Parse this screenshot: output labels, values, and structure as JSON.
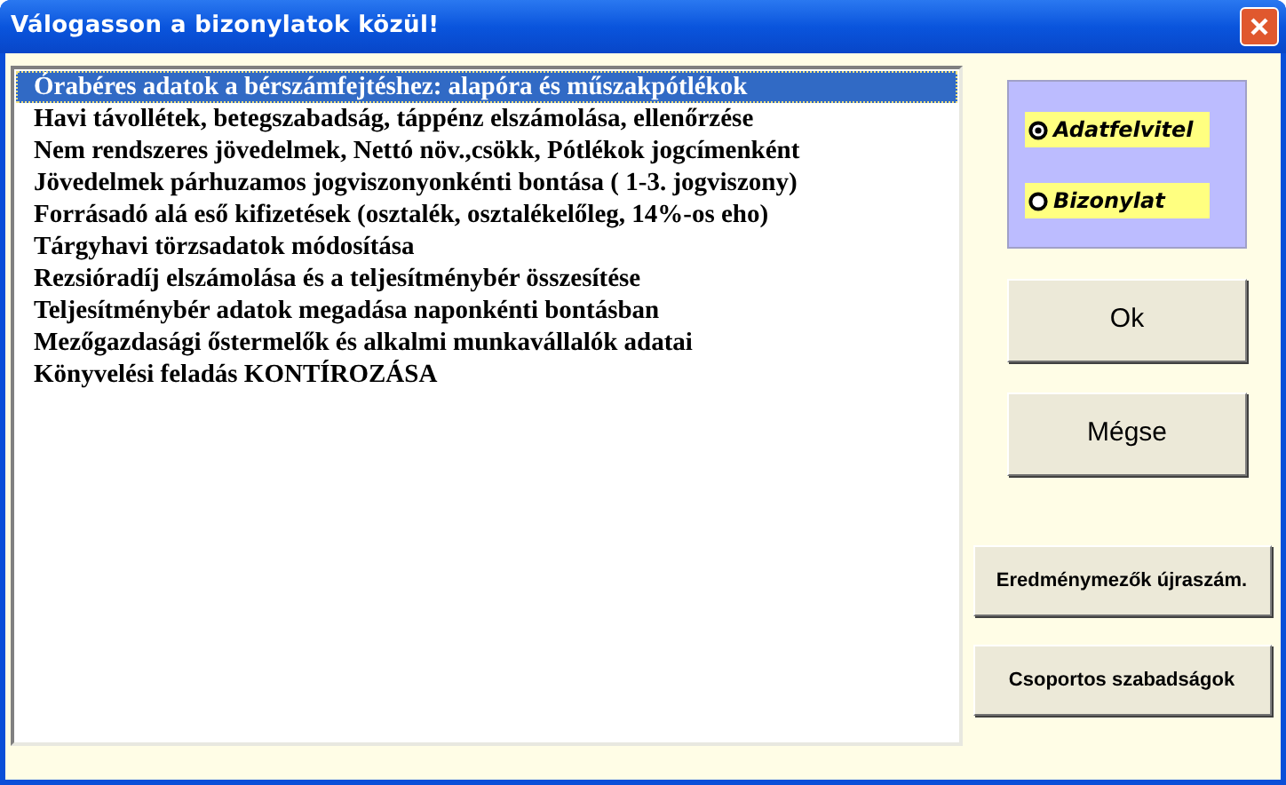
{
  "window": {
    "title": "Válogasson a bizonylatok közül!"
  },
  "list": {
    "items": [
      {
        "label": "Órabéres adatok a bérszámfejtéshez: alapóra és műszakpótlékok",
        "selected": true
      },
      {
        "label": "Havi távollétek, betegszabadság, táppénz elszámolása, ellenőrzése",
        "selected": false
      },
      {
        "label": "Nem rendszeres jövedelmek, Nettó növ.,csökk, Pótlékok jogcímenként",
        "selected": false
      },
      {
        "label": "Jövedelmek párhuzamos jogviszonyonkénti bontása ( 1-3. jogviszony)",
        "selected": false
      },
      {
        "label": "Forrásadó alá eső kifizetések (osztalék, osztalékelőleg, 14%-os eho)",
        "selected": false
      },
      {
        "label": "Tárgyhavi törzsadatok módosítása",
        "selected": false
      },
      {
        "label": "Rezsióradíj elszámolása és a teljesítménybér összesítése",
        "selected": false
      },
      {
        "label": "Teljesítménybér adatok megadása naponkénti bontásban",
        "selected": false
      },
      {
        "label": "Mezőgazdasági őstermelők és alkalmi munkavállalók adatai",
        "selected": false
      },
      {
        "label": "Könyvelési feladás KONTÍROZÁSA",
        "selected": false
      }
    ]
  },
  "mode_options": [
    {
      "label": "Adatfelvitel",
      "selected": true
    },
    {
      "label": "Bizonylat",
      "selected": false
    }
  ],
  "buttons": {
    "primary": [
      "Ok",
      "Mégse"
    ],
    "secondary": [
      "Eredménymezők újraszám.",
      "Csoportos szabadságok"
    ]
  }
}
